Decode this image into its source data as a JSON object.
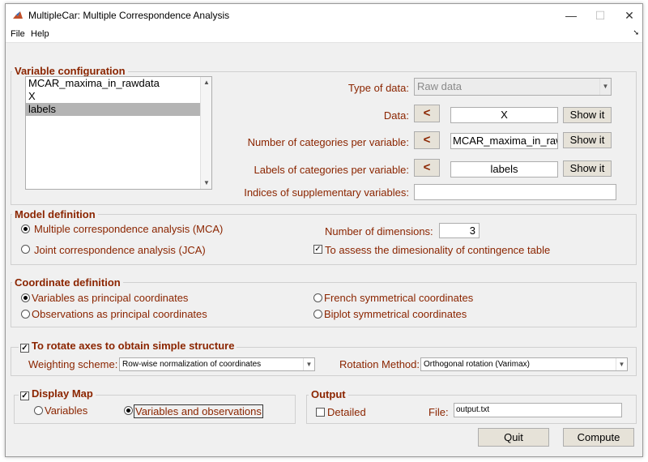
{
  "window": {
    "title": "MultipleCar: Multiple Correspondence Analysis",
    "minimize": "—",
    "maximize": "☐",
    "close": "✕"
  },
  "menu": {
    "file": "File",
    "help": "Help"
  },
  "variable_config": {
    "title": "Variable configuration",
    "list_items": [
      "MCAR_maxima_in_rawdata",
      "X",
      "labels"
    ],
    "selected_index": 2,
    "type_label": "Type of data:",
    "type_value": "Raw data",
    "data_label": "Data:",
    "data_value": "X",
    "ncat_label": "Number of categories per variable:",
    "ncat_value": "MCAR_maxima_in_raw",
    "labels_label": "Labels of categories per variable:",
    "labels_value": "labels",
    "supp_label": "Indices of supplementary variables:",
    "supp_value": "",
    "arrow": "<",
    "show_it": "Show it"
  },
  "model": {
    "title": "Model definition",
    "mca": "Multiple correspondence analysis (MCA)",
    "jca": "Joint correspondence analysis (JCA)",
    "dims_label": "Number of dimensions:",
    "dims_value": "3",
    "assess_label": "To assess the dimesionality of contingence table",
    "mca_selected": true,
    "assess_checked": true
  },
  "coordinates": {
    "title": "Coordinate definition",
    "var_principal": "Variables as principal coordinates",
    "obs_principal": "Observations as principal coordinates",
    "french": "French symmetrical coordinates",
    "biplot": "Biplot symmetrical coordinates",
    "selected": "var_principal"
  },
  "rotation": {
    "title": "To rotate axes to obtain simple structure",
    "checked": true,
    "weighting_label": "Weighting scheme:",
    "weighting_value": "Row-wise normalization of coordinates",
    "method_label": "Rotation Method:",
    "method_value": "Orthogonal rotation (Varimax)"
  },
  "display_map": {
    "title": "Display Map",
    "checked": true,
    "variables": "Variables",
    "var_obs": "Variables and observations",
    "selected": "var_obs"
  },
  "output": {
    "title": "Output",
    "detailed": "Detailed",
    "detailed_checked": false,
    "file_label": "File:",
    "file_value": "output.txt"
  },
  "actions": {
    "quit": "Quit",
    "compute": "Compute"
  },
  "colors": {
    "label": "#8b2500",
    "button": "#e6e2d8",
    "selection": "#b4b4b4"
  }
}
